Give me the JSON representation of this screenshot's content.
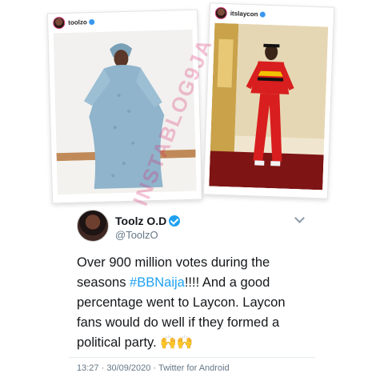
{
  "left_post": {
    "username": "toolzo"
  },
  "right_post": {
    "username": "itslaycon"
  },
  "tweet": {
    "display_name": "Toolz O.D",
    "handle": "@ToolzO",
    "text_before": "Over 900 million votes during the seasons ",
    "hashtag": "#BBNaija",
    "text_after": "!!!! And a good percentage went to Laycon. Laycon fans would do well if they formed a political party. 🙌🙌",
    "time": "13:27",
    "date": "30/09/2020",
    "client": "Twitter for Android",
    "separator": "·"
  },
  "watermark": "INSTABLOG9JA",
  "colors": {
    "link": "#1da1f2",
    "verified": "#1da1f2"
  }
}
